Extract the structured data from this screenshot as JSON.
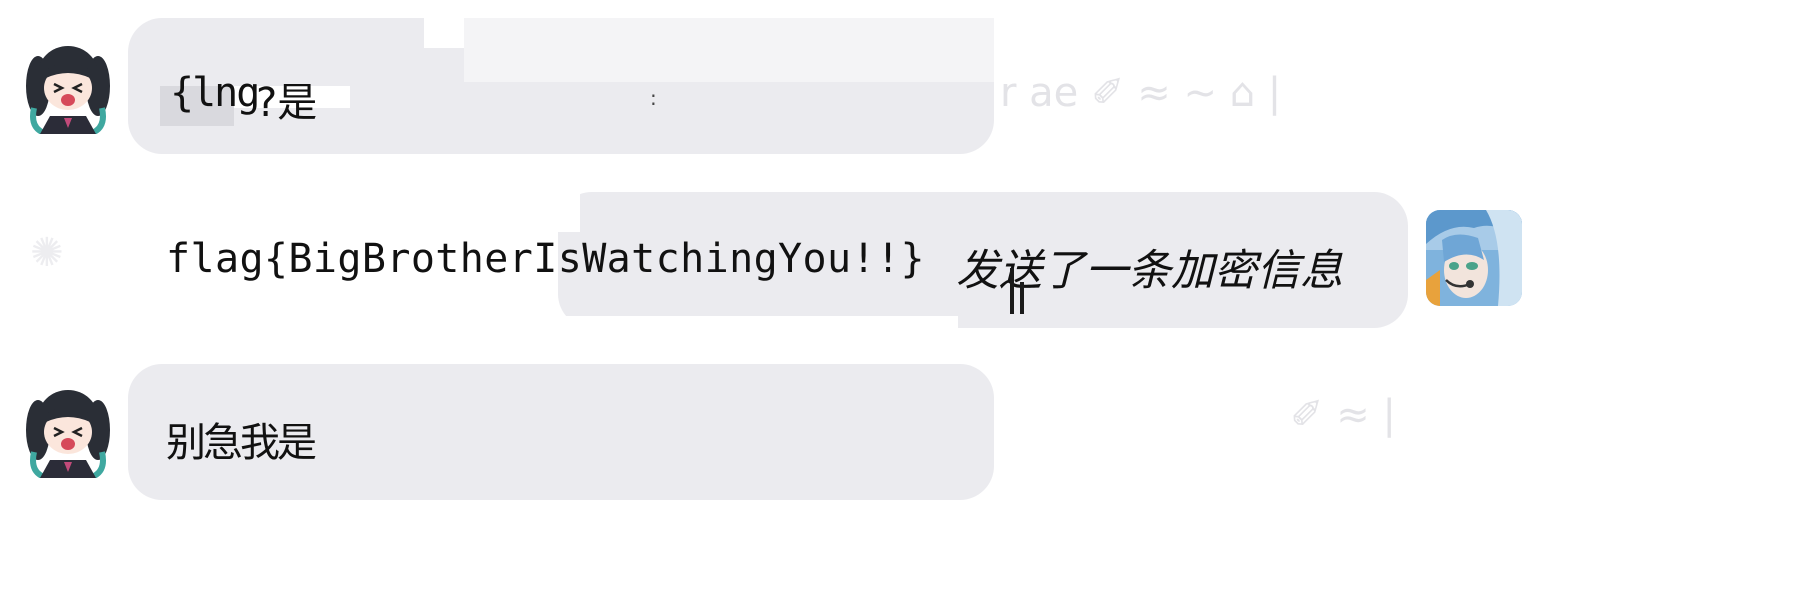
{
  "messages": [
    {
      "side": "left",
      "sender": "girl-twintails",
      "text_visible": "{lng?是",
      "text_prefix": "{lng",
      "text_suffix": "?是",
      "stray_mark": ":"
    },
    {
      "side": "right",
      "sender": "blue-hair-headset",
      "flag_text": "flag{BigBrotherIsWatchingYou!!}",
      "suffix_text": "发送了一条加密信息"
    },
    {
      "side": "left",
      "sender": "girl-twintails",
      "text": "别急我是"
    }
  ],
  "colors": {
    "bubble": "#ebebef",
    "patch": "#f4f4f6",
    "text": "#111111"
  }
}
